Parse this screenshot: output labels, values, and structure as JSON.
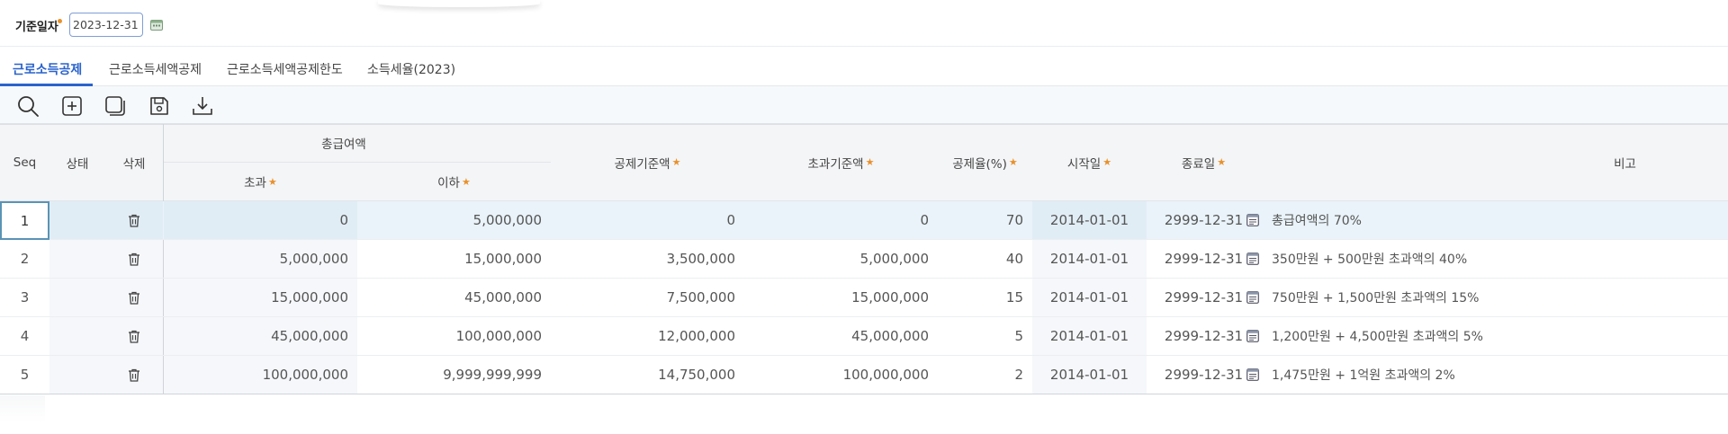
{
  "filter": {
    "label": "기준일자",
    "date_value": "2023-12-31"
  },
  "tabs": [
    {
      "label": "근로소득공제",
      "active": true
    },
    {
      "label": "근로소득세액공제",
      "active": false
    },
    {
      "label": "근로소득세액공제한도",
      "active": false
    },
    {
      "label": "소득세율(2023)",
      "active": false
    }
  ],
  "toolbar": {
    "icons": [
      "search-icon",
      "add-icon",
      "copy-icon",
      "save-icon",
      "download-icon"
    ]
  },
  "table": {
    "headers": {
      "seq": "Seq",
      "status": "상태",
      "delete": "삭제",
      "total_pay": "총급여액",
      "over": "초과",
      "under": "이하",
      "deduction_base": "공제기준액",
      "excess_base": "초과기준액",
      "deduction_rate": "공제율(%)",
      "start_date": "시작일",
      "end_date": "종료일",
      "remarks": "비고"
    },
    "rows": [
      {
        "seq": "1",
        "over": "0",
        "under": "5,000,000",
        "deduction_base": "0",
        "excess_base": "0",
        "rate": "70",
        "start": "2014-01-01",
        "end": "2999-12-31",
        "remark": "총급여액의 70%"
      },
      {
        "seq": "2",
        "over": "5,000,000",
        "under": "15,000,000",
        "deduction_base": "3,500,000",
        "excess_base": "5,000,000",
        "rate": "40",
        "start": "2014-01-01",
        "end": "2999-12-31",
        "remark": "350만원 + 500만원 초과액의 40%"
      },
      {
        "seq": "3",
        "over": "15,000,000",
        "under": "45,000,000",
        "deduction_base": "7,500,000",
        "excess_base": "15,000,000",
        "rate": "15",
        "start": "2014-01-01",
        "end": "2999-12-31",
        "remark": "750만원 + 1,500만원 초과액의 15%"
      },
      {
        "seq": "4",
        "over": "45,000,000",
        "under": "100,000,000",
        "deduction_base": "12,000,000",
        "excess_base": "45,000,000",
        "rate": "5",
        "start": "2014-01-01",
        "end": "2999-12-31",
        "remark": "1,200만원 + 4,500만원 초과액의 5%"
      },
      {
        "seq": "5",
        "over": "100,000,000",
        "under": "9,999,999,999",
        "deduction_base": "14,750,000",
        "excess_base": "100,000,000",
        "rate": "2",
        "start": "2014-01-01",
        "end": "2999-12-31",
        "remark": "1,475만원 + 1억원 초과액의 2%"
      }
    ]
  },
  "colors": {
    "accent": "#2a63cc",
    "required_star": "#e8912b",
    "selected_row": "#e9f3f9"
  }
}
